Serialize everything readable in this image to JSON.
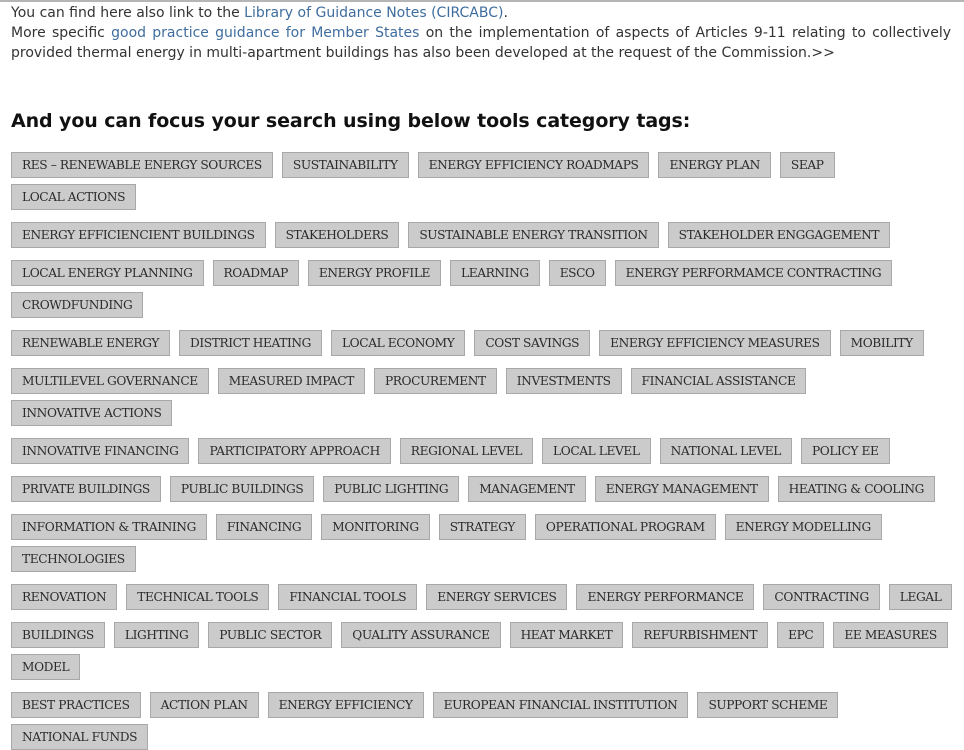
{
  "intro": {
    "line1_prefix": "You can find here also link to the ",
    "line1_link": "Library of Guidance Notes (CIRCABC)",
    "line1_suffix": ".",
    "line2_prefix": "More specific ",
    "line2_link": "good practice guidance for Member States",
    "line2_suffix": " on the implementation of aspects of Articles 9-11 relating to collectively provided thermal energy in multi-apartment buildings has also been developed at the request of the Commission.>>"
  },
  "heading": "And you can focus your search using below tools category tags:",
  "tag_rows": [
    [
      "RES – RENEWABLE ENERGY SOURCES",
      "SUSTAINABILITY",
      "ENERGY EFFICIENCY ROADMAPS",
      "ENERGY PLAN",
      "SEAP",
      "LOCAL ACTIONS"
    ],
    [
      "ENERGY EFFICIENCIENT BUILDINGS",
      "STAKEHOLDERS",
      "SUSTAINABLE ENERGY TRANSITION",
      "STAKEHOLDER ENGGAGEMENT"
    ],
    [
      "LOCAL ENERGY PLANNING",
      "ROADMAP",
      "ENERGY PROFILE",
      "LEARNING",
      "ESCO",
      "ENERGY PERFORMAMCE CONTRACTING",
      "CROWDFUNDING"
    ],
    [
      "RENEWABLE ENERGY",
      "DISTRICT HEATING",
      "LOCAL ECONOMY",
      "COST SAVINGS",
      "ENERGY EFFICIENCY MEASURES",
      "MOBILITY"
    ],
    [
      "MULTILEVEL GOVERNANCE",
      "MEASURED IMPACT",
      "PROCUREMENT",
      "INVESTMENTS",
      "FINANCIAL ASSISTANCE",
      "INNOVATIVE ACTIONS"
    ],
    [
      "INNOVATIVE FINANCING",
      "PARTICIPATORY APPROACH",
      "REGIONAL LEVEL",
      "LOCAL LEVEL",
      "NATIONAL LEVEL",
      "POLICY EE"
    ],
    [
      "PRIVATE BUILDINGS",
      "PUBLIC BUILDINGS",
      "PUBLIC LIGHTING",
      "MANAGEMENT",
      "ENERGY MANAGEMENT",
      "HEATING & COOLING"
    ],
    [
      "INFORMATION & TRAINING",
      "FINANCING",
      "MONITORING",
      "STRATEGY",
      "OPERATIONAL PROGRAM",
      "ENERGY MODELLING",
      "TECHNOLOGIES"
    ],
    [
      "RENOVATION",
      "TECHNICAL TOOLS",
      "FINANCIAL TOOLS",
      "ENERGY SERVICES",
      "ENERGY PERFORMANCE",
      "CONTRACTING",
      "LEGAL"
    ],
    [
      "BUILDINGS",
      "LIGHTING",
      "PUBLIC SECTOR",
      "QUALITY ASSURANCE",
      "HEAT MARKET",
      "REFURBISHMENT",
      "EPC",
      "EE MEASURES",
      "MODEL"
    ],
    [
      "BEST PRACTICES",
      "ACTION PLAN",
      "ENERGY EFFICIENCY",
      "EUROPEAN FINANCIAL INSTITUTION",
      "SUPPORT SCHEME",
      "NATIONAL FUNDS"
    ]
  ]
}
